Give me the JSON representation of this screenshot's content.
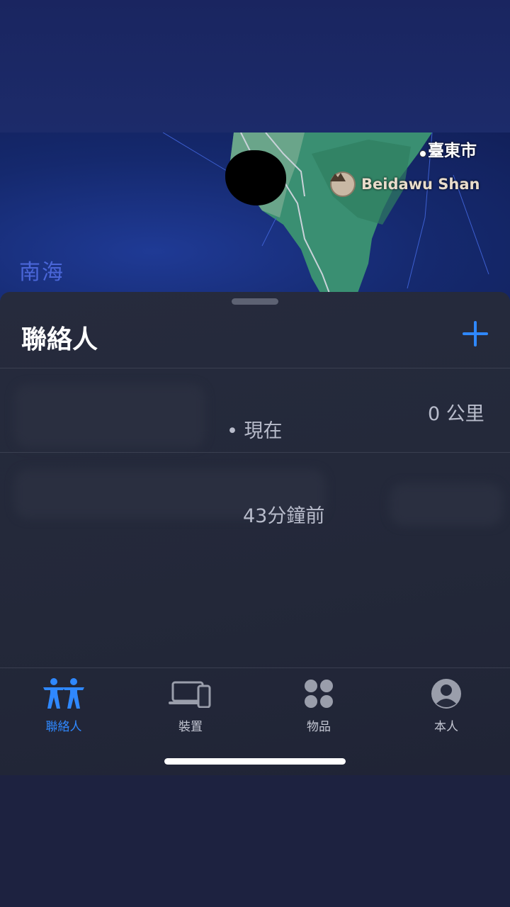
{
  "map": {
    "sea_label": "南海",
    "city_label": "臺東市",
    "poi_label": "Beidawu Shan",
    "poi_icon": "mountain-icon"
  },
  "sheet": {
    "title": "聯絡人",
    "add_icon": "plus-icon"
  },
  "people": [
    {
      "distance": "0 公里",
      "status": "• 現在"
    },
    {
      "distance": "",
      "status": "43分鐘前"
    }
  ],
  "tabs": [
    {
      "label": "聯絡人",
      "icon": "people-icon",
      "active": true
    },
    {
      "label": "裝置",
      "icon": "devices-icon",
      "active": false
    },
    {
      "label": "物品",
      "icon": "items-icon",
      "active": false
    },
    {
      "label": "本人",
      "icon": "me-icon",
      "active": false
    }
  ],
  "colors": {
    "accent": "#2f88ff",
    "sheet_bg": "#262b3d",
    "map_sea": "#15296e",
    "land": "#3f9a78"
  }
}
